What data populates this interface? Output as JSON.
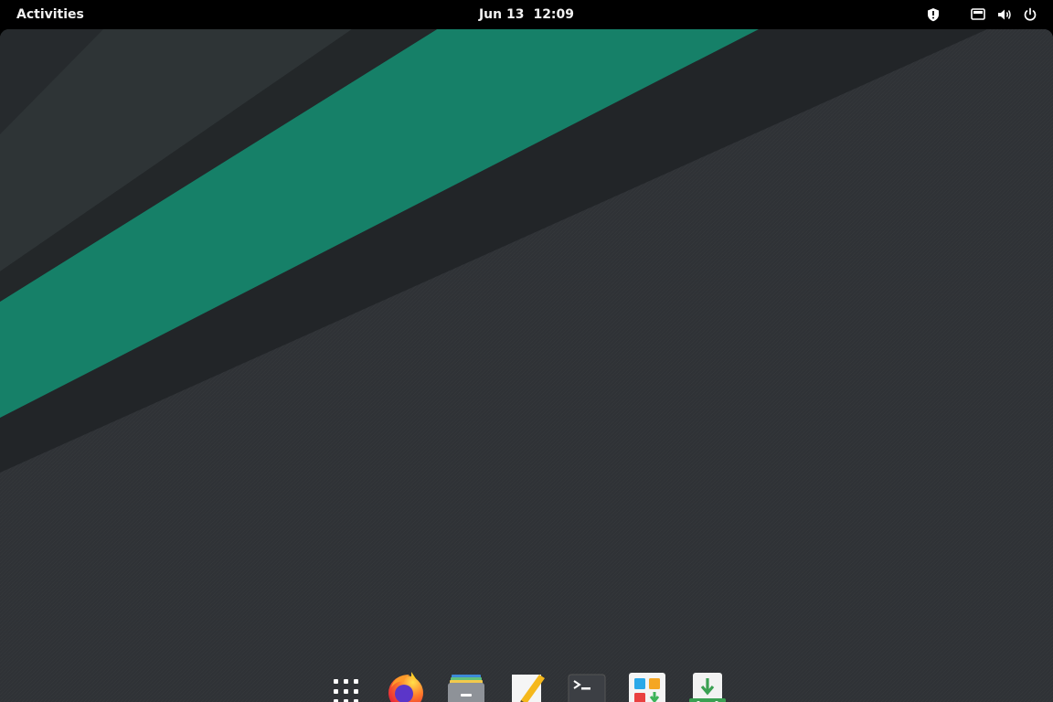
{
  "topbar": {
    "activities_label": "Activities",
    "date": "Jun 13",
    "time": "12:09",
    "tray_icons": [
      "shield-icon",
      "network-icon",
      "volume-icon",
      "power-icon"
    ]
  },
  "dock": {
    "apps": [
      {
        "name": "show-apps",
        "icon": "grid-icon"
      },
      {
        "name": "firefox",
        "icon": "firefox-icon"
      },
      {
        "name": "files",
        "icon": "files-icon"
      },
      {
        "name": "text-editor",
        "icon": "text-editor-icon"
      },
      {
        "name": "terminal",
        "icon": "terminal-icon"
      },
      {
        "name": "software",
        "icon": "software-icon"
      },
      {
        "name": "installer",
        "icon": "installer-icon"
      }
    ]
  },
  "colors": {
    "topbar": "#000000",
    "wallpaper_base": "#2f3236",
    "wallpaper_stripe_dark": "#222528",
    "wallpaper_stripe_mid": "#2e3436",
    "accent_green": "#168068"
  }
}
